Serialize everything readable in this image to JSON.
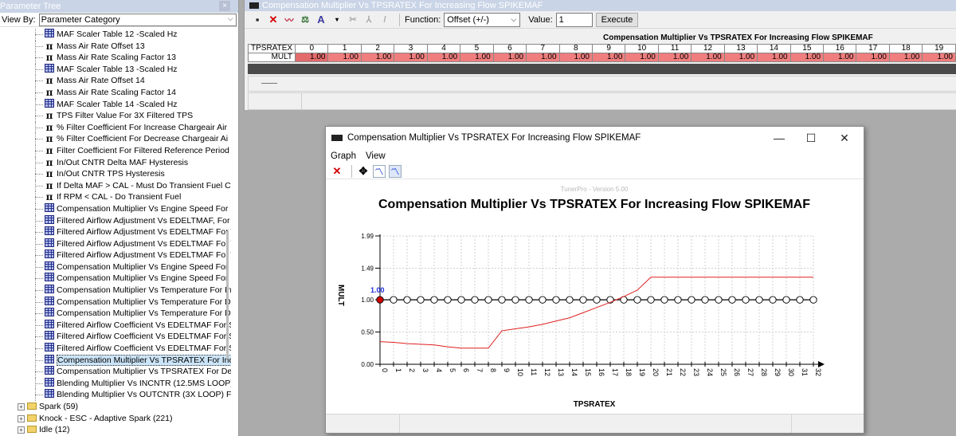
{
  "tree": {
    "title": "Parameter Tree",
    "close": "×",
    "view_by_label": "View By:",
    "view_by_value": "Parameter Category",
    "items": [
      {
        "icon": "table",
        "label": "MAF Scaler Table 12 -Scaled Hz"
      },
      {
        "icon": "pi",
        "label": "Mass Air Rate Offset 13"
      },
      {
        "icon": "pi",
        "label": "Mass Air Rate Scaling Factor 13"
      },
      {
        "icon": "table",
        "label": "MAF Scaler Table 13 -Scaled Hz"
      },
      {
        "icon": "pi",
        "label": "Mass Air Rate Offset 14"
      },
      {
        "icon": "pi",
        "label": "Mass Air Rate Scaling Factor 14"
      },
      {
        "icon": "table",
        "label": "MAF Scaler Table 14 -Scaled Hz"
      },
      {
        "icon": "pi",
        "label": "TPS Filter Value For 3X Filtered TPS"
      },
      {
        "icon": "pi",
        "label": "% Filter Coefficient For Increase Chargeair Air"
      },
      {
        "icon": "pi",
        "label": "% Filter Coefficient For Decrease Chargeair Ai"
      },
      {
        "icon": "pi",
        "label": "Filter Coefficient For Filtered Reference Period"
      },
      {
        "icon": "pi",
        "label": "In/Out CNTR Delta MAF Hysteresis"
      },
      {
        "icon": "pi",
        "label": "In/Out CNTR TPS Hysteresis"
      },
      {
        "icon": "pi",
        "label": "If Delta MAF > CAL - Must Do Transient Fuel C"
      },
      {
        "icon": "pi",
        "label": "If RPM < CAL - Do Transient Fuel"
      },
      {
        "icon": "table",
        "label": "Compensation Multiplier Vs Engine Speed For E"
      },
      {
        "icon": "table",
        "label": "Filtered Airflow Adjustment Vs EDELTMAF, For"
      },
      {
        "icon": "table",
        "label": "Filtered Airflow Adjustment Vs EDELTMAF For T"
      },
      {
        "icon": "table",
        "label": "Filtered Airflow Adjustment Vs EDELTMAF For T"
      },
      {
        "icon": "table",
        "label": "Filtered Airflow Adjustment Vs EDELTMAF For T"
      },
      {
        "icon": "table",
        "label": "Compensation Multiplier Vs Engine Speed For In"
      },
      {
        "icon": "table",
        "label": "Compensation Multiplier Vs Engine Speed For D"
      },
      {
        "icon": "table",
        "label": "Compensation Multiplier Vs Temperature For In"
      },
      {
        "icon": "table",
        "label": "Compensation Multiplier Vs Temperature For De"
      },
      {
        "icon": "table",
        "label": "Compensation Multiplier Vs Temperature For De"
      },
      {
        "icon": "table",
        "label": "Filtered Airflow Coefficient Vs EDELTMAF For S"
      },
      {
        "icon": "table",
        "label": "Filtered Airflow Coefficient Vs EDELTMAF For S"
      },
      {
        "icon": "table",
        "label": "Filtered Airflow Coefficient Vs EDELTMAF For S"
      },
      {
        "icon": "table",
        "label": "Compensation Multiplier Vs TPSRATEX For Incr",
        "selected": true
      },
      {
        "icon": "table",
        "label": "Compensation Multiplier Vs TPSRATEX For Decr"
      },
      {
        "icon": "table",
        "label": "Blending Multiplier Vs INCNTR (12.5MS LOOP) f"
      },
      {
        "icon": "table",
        "label": "Blending Multiplier Vs OUTCNTR (3X LOOP) For"
      }
    ],
    "folders": [
      {
        "label": "Spark (59)"
      },
      {
        "label": "Knock - ESC - Adaptive Spark (221)"
      },
      {
        "label": "Idle (12)"
      }
    ]
  },
  "table_window": {
    "title": "Compensation Multiplier Vs TPSRATEX For Increasing Flow SPIKEMAF",
    "function_label": "Function:",
    "function_value": "Offset (+/-)",
    "value_label": "Value:",
    "value": "1",
    "execute_label": "Execute",
    "grid_title": "Compensation Multiplier Vs TPSRATEX For Increasing Flow SPIKEMAF",
    "row_axis_label": "TPSRATEX",
    "row_label": "MULT",
    "columns": [
      "0",
      "1",
      "2",
      "3",
      "4",
      "5",
      "6",
      "7",
      "8",
      "9",
      "10",
      "11",
      "12",
      "13",
      "14",
      "15",
      "16",
      "17",
      "18",
      "19"
    ],
    "values": [
      "1.00",
      "1.00",
      "1.00",
      "1.00",
      "1.00",
      "1.00",
      "1.00",
      "1.00",
      "1.00",
      "1.00",
      "1.00",
      "1.00",
      "1.00",
      "1.00",
      "1.00",
      "1.00",
      "1.00",
      "1.00",
      "1.00",
      "1.00"
    ]
  },
  "graph_window": {
    "title": "Compensation Multiplier Vs TPSRATEX For Increasing Flow SPIKEMAF",
    "menu": [
      "Graph",
      "View"
    ],
    "minimize": "—",
    "maximize": "☐",
    "close": "✕"
  },
  "chart_data": {
    "type": "line",
    "title": "Compensation Multiplier Vs TPSRATEX For Increasing Flow SPIKEMAF",
    "watermark": "TunerPro - Version 5.00",
    "xlabel": "TPSRATEX",
    "ylabel": "MULT",
    "x": [
      0,
      1,
      2,
      3,
      4,
      5,
      6,
      7,
      8,
      9,
      10,
      11,
      12,
      13,
      14,
      15,
      16,
      17,
      18,
      19,
      20,
      21,
      22,
      23,
      24,
      25,
      26,
      27,
      28,
      29,
      30,
      31,
      32
    ],
    "yticks": [
      {
        "label": "0.00",
        "value": 0.0
      },
      {
        "label": "0.50",
        "value": 0.5
      },
      {
        "label": "1.00",
        "value": 1.0
      },
      {
        "label": "1.49",
        "value": 1.49
      },
      {
        "label": "1.99",
        "value": 1.99
      }
    ],
    "ylim": [
      0,
      1.99
    ],
    "xlim": [
      0,
      32
    ],
    "grid": true,
    "selected_index": 0,
    "selected_label": "1.00",
    "series": [
      {
        "role": "edited",
        "color": "#000000",
        "values": [
          1.0,
          1.0,
          1.0,
          1.0,
          1.0,
          1.0,
          1.0,
          1.0,
          1.0,
          1.0,
          1.0,
          1.0,
          1.0,
          1.0,
          1.0,
          1.0,
          1.0,
          1.0,
          1.0,
          1.0,
          1.0,
          1.0,
          1.0,
          1.0,
          1.0,
          1.0,
          1.0,
          1.0,
          1.0,
          1.0,
          1.0,
          1.0,
          1.0
        ]
      },
      {
        "role": "original",
        "color": "#e02020",
        "values": [
          0.35,
          0.34,
          0.32,
          0.31,
          0.3,
          0.27,
          0.25,
          0.25,
          0.25,
          0.52,
          0.55,
          0.58,
          0.62,
          0.67,
          0.72,
          0.8,
          0.88,
          0.96,
          1.05,
          1.15,
          1.35,
          1.35,
          1.35,
          1.35,
          1.35,
          1.35,
          1.35,
          1.35,
          1.35,
          1.35,
          1.35,
          1.35,
          1.35
        ]
      }
    ]
  }
}
